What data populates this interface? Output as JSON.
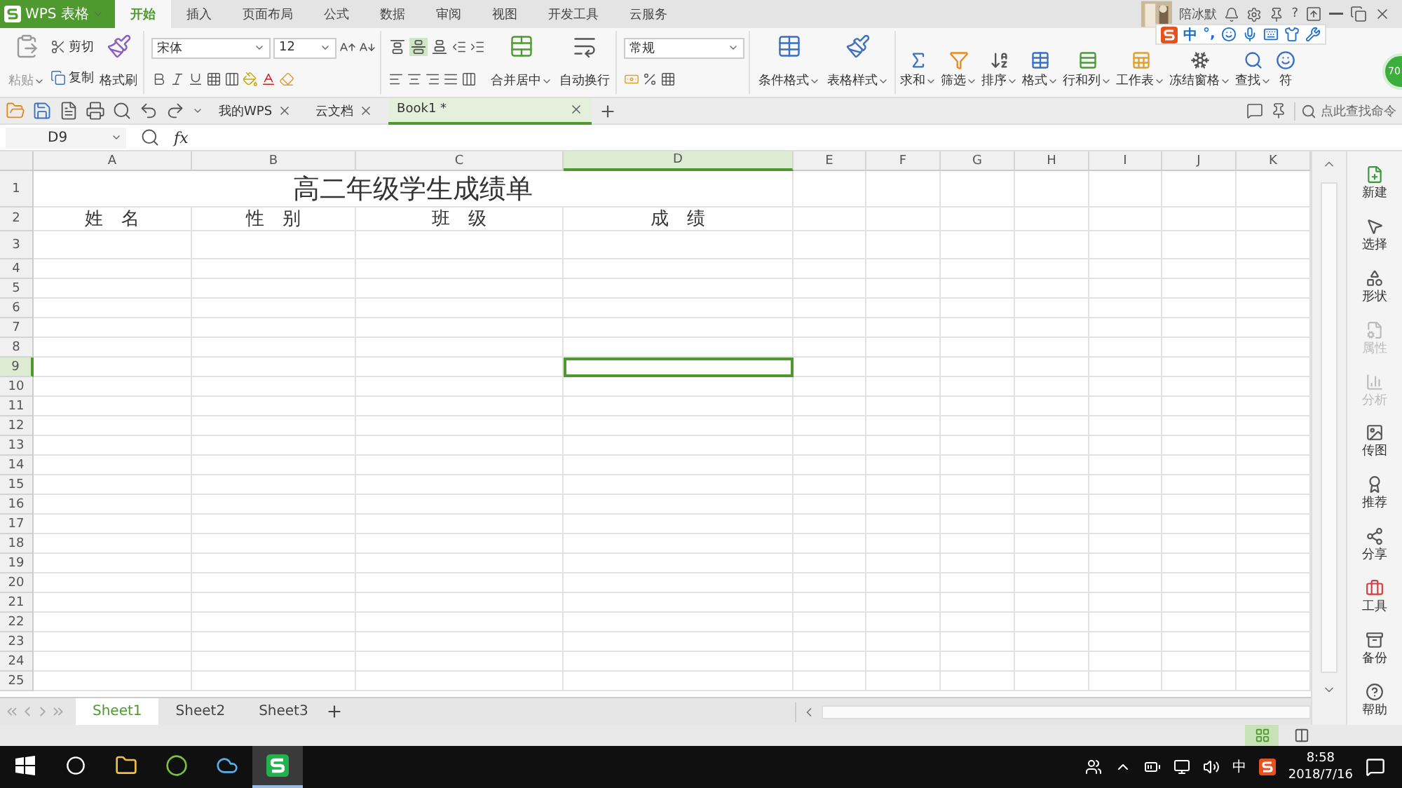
{
  "title_bar": {
    "app_name": "WPS 表格",
    "user_name": "陪冰默",
    "help": "?"
  },
  "ribbon_tabs": [
    {
      "label": "开始",
      "selected": true
    },
    {
      "label": "插入",
      "selected": false
    },
    {
      "label": "页面布局",
      "selected": false
    },
    {
      "label": "公式",
      "selected": false
    },
    {
      "label": "数据",
      "selected": false
    },
    {
      "label": "审阅",
      "selected": false
    },
    {
      "label": "视图",
      "selected": false
    },
    {
      "label": "开发工具",
      "selected": false
    },
    {
      "label": "云服务",
      "selected": false
    }
  ],
  "ime_bar": {
    "mode": "中",
    "punctuation": "°,"
  },
  "float_badge": "70",
  "ribbon": {
    "clipboard": {
      "paste": "粘贴",
      "cut": "剪切",
      "copy": "复制",
      "format_painter": "格式刷"
    },
    "font": {
      "name": "宋体",
      "size": "12"
    },
    "vertical_align": [
      {
        "selected": false
      },
      {
        "selected": true
      },
      {
        "selected": false
      }
    ],
    "alignment": {
      "merge": "合并居中",
      "wrap": "自动换行"
    },
    "number": {
      "format": "常规"
    },
    "styles": [
      "条件格式",
      "表格样式"
    ],
    "tools": [
      "求和",
      "筛选",
      "排序",
      "格式",
      "行和列",
      "工作表",
      "冻结窗格",
      "查找",
      "符"
    ]
  },
  "doc_tabs": [
    {
      "label": "我的WPS",
      "selected": false
    },
    {
      "label": "云文档",
      "selected": false
    },
    {
      "label": "Book1 *",
      "selected": true
    }
  ],
  "command_search": {
    "placeholder": "点此查找命令"
  },
  "formula_bar": {
    "name_box": "D9",
    "fx": "fx"
  },
  "sheet": {
    "columns": [
      {
        "label": "A",
        "selected": false
      },
      {
        "label": "B",
        "selected": false
      },
      {
        "label": "C",
        "selected": false
      },
      {
        "label": "D",
        "selected": true
      },
      {
        "label": "E",
        "selected": false
      },
      {
        "label": "F",
        "selected": false
      },
      {
        "label": "G",
        "selected": false
      },
      {
        "label": "H",
        "selected": false
      },
      {
        "label": "I",
        "selected": false
      },
      {
        "label": "J",
        "selected": false
      },
      {
        "label": "K",
        "selected": false
      }
    ],
    "title": "高二年级学生成绩单",
    "header_cells": [
      "姓　名",
      "性　别",
      "班　级",
      "成　绩"
    ],
    "rows": [
      {
        "label": "1",
        "selected": false
      },
      {
        "label": "2",
        "selected": false
      },
      {
        "label": "3",
        "selected": false
      },
      {
        "label": "4",
        "selected": false
      },
      {
        "label": "5",
        "selected": false
      },
      {
        "label": "6",
        "selected": false
      },
      {
        "label": "7",
        "selected": false
      },
      {
        "label": "8",
        "selected": false
      },
      {
        "label": "9",
        "selected": true
      },
      {
        "label": "10",
        "selected": false
      },
      {
        "label": "11",
        "selected": false
      },
      {
        "label": "12",
        "selected": false
      },
      {
        "label": "13",
        "selected": false
      },
      {
        "label": "14",
        "selected": false
      },
      {
        "label": "15",
        "selected": false
      },
      {
        "label": "16",
        "selected": false
      },
      {
        "label": "17",
        "selected": false
      },
      {
        "label": "18",
        "selected": false
      },
      {
        "label": "19",
        "selected": false
      },
      {
        "label": "20",
        "selected": false
      },
      {
        "label": "21",
        "selected": false
      },
      {
        "label": "22",
        "selected": false
      },
      {
        "label": "23",
        "selected": false
      },
      {
        "label": "24",
        "selected": false
      },
      {
        "label": "25",
        "selected": false
      }
    ]
  },
  "sidebar": [
    {
      "label": "新建",
      "disabled": false
    },
    {
      "label": "选择",
      "disabled": false
    },
    {
      "label": "形状",
      "disabled": false
    },
    {
      "label": "属性",
      "disabled": true
    },
    {
      "label": "分析",
      "disabled": true
    },
    {
      "label": "传图",
      "disabled": false
    },
    {
      "label": "推荐",
      "disabled": false
    },
    {
      "label": "分享",
      "disabled": false
    },
    {
      "label": "工具",
      "disabled": false
    },
    {
      "label": "备份",
      "disabled": false
    },
    {
      "label": "帮助",
      "disabled": false
    }
  ],
  "sheet_tabs": [
    {
      "label": "Sheet1",
      "selected": true
    },
    {
      "label": "Sheet2",
      "selected": false
    },
    {
      "label": "Sheet3",
      "selected": false
    }
  ],
  "view_modes": [
    {
      "selected": true
    },
    {
      "selected": false
    }
  ],
  "taskbar": {
    "apps": [
      {
        "selected": false
      },
      {
        "selected": false
      },
      {
        "selected": false
      },
      {
        "selected": true
      }
    ],
    "ime": "中",
    "time": "8:58",
    "date": "2018/7/16"
  }
}
